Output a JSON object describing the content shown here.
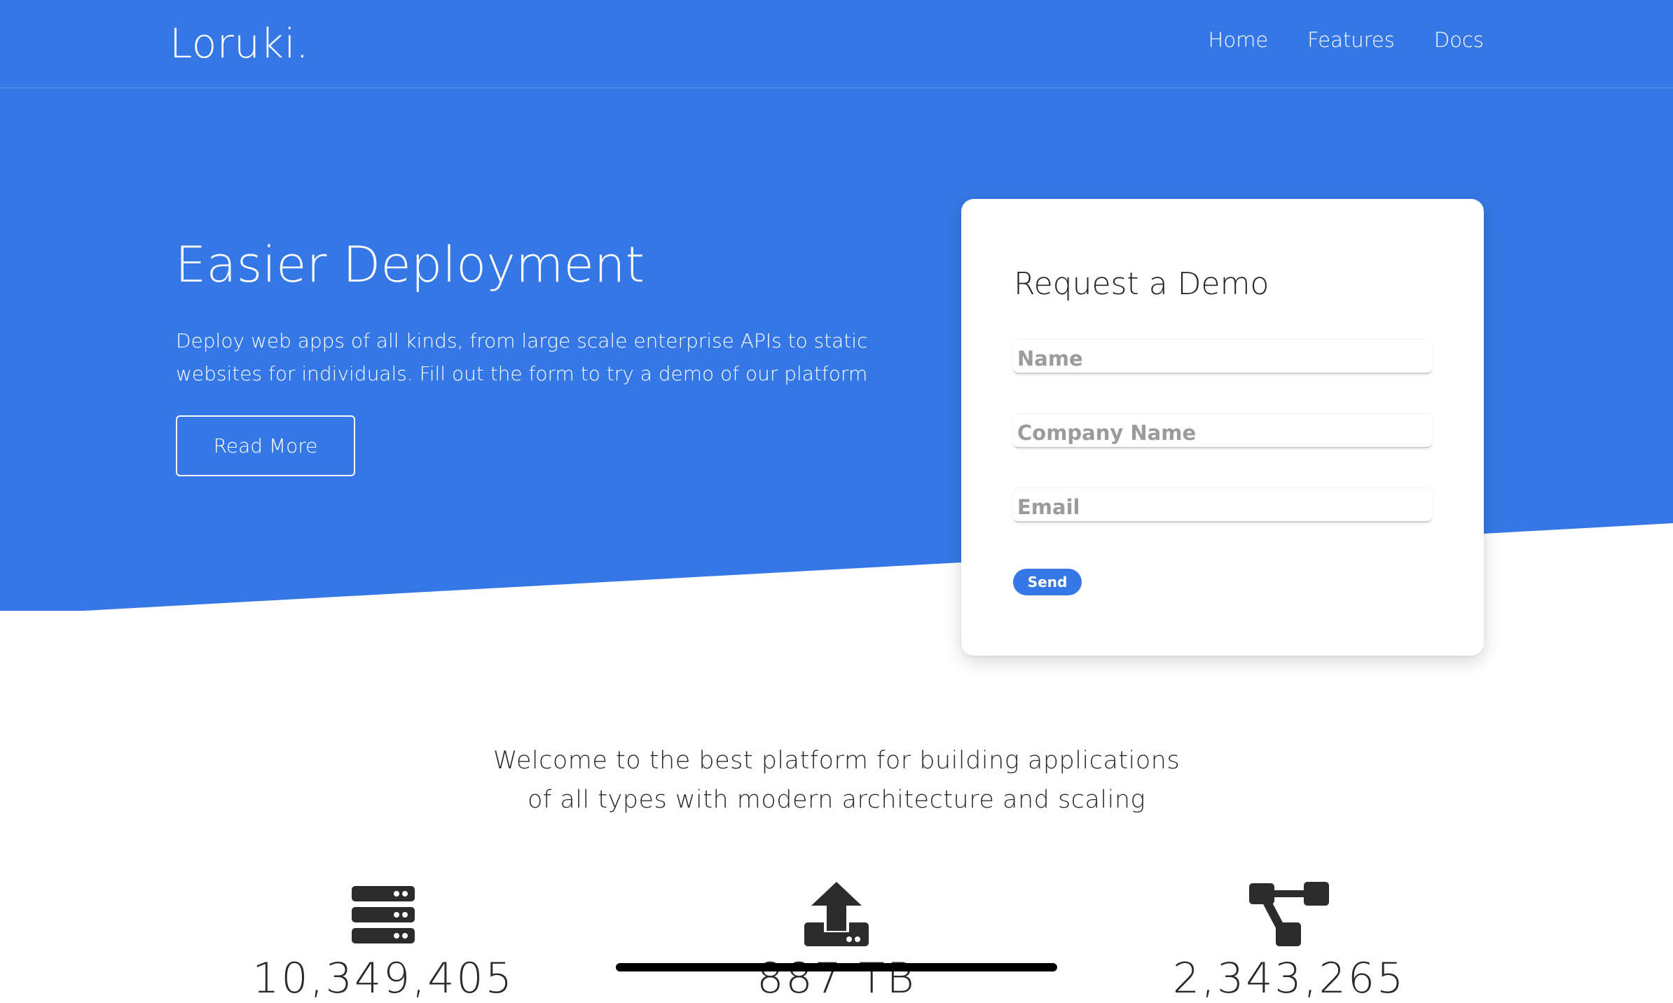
{
  "colors": {
    "brand": "#3578e5",
    "text_dark": "#2a2a2a",
    "placeholder": "#9b9b9b"
  },
  "header": {
    "logo": "Loruki.",
    "nav": [
      {
        "label": "Home"
      },
      {
        "label": "Features"
      },
      {
        "label": "Docs"
      }
    ]
  },
  "hero": {
    "title": "Easier Deployment",
    "description": "Deploy web apps of all kinds, from large scale enterprise APIs to static websites for individuals. Fill out the form to try a demo of our platform",
    "read_more_label": "Read More"
  },
  "form": {
    "title": "Request a Demo",
    "name_placeholder": "Name",
    "company_placeholder": "Company Name",
    "email_placeholder": "Email",
    "send_label": "Send"
  },
  "welcome": {
    "line1": "Welcome to the best platform for building applications",
    "line2": "of all types with modern architecture and scaling"
  },
  "stats": [
    {
      "icon": "server-icon",
      "value": "10,349,405"
    },
    {
      "icon": "upload-icon",
      "value": "887 TB"
    },
    {
      "icon": "project-diagram-icon",
      "value": "2,343,265"
    }
  ]
}
